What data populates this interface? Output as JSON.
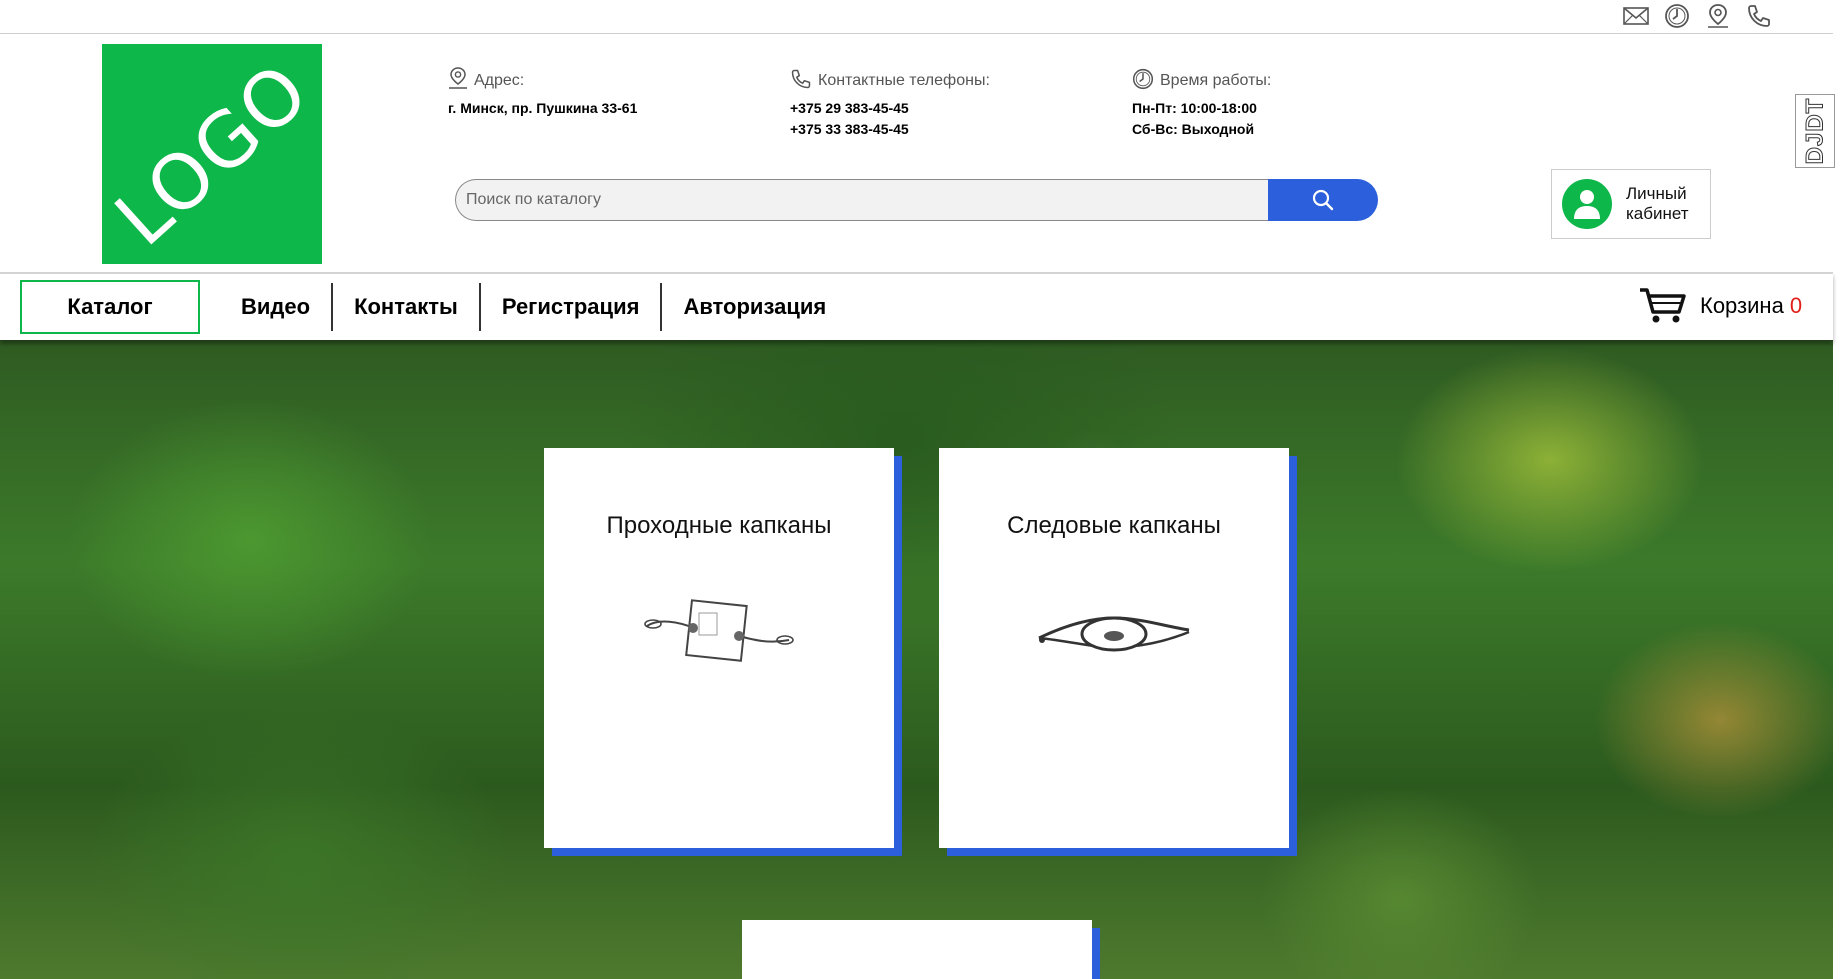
{
  "topbar": {
    "icons": [
      "mail-icon",
      "clock-icon",
      "location-pin-icon",
      "phone-icon"
    ]
  },
  "header": {
    "logo_text": "LOGO",
    "address": {
      "label": "Адрес:",
      "value": "г. Минск, пр. Пушкина 33-61"
    },
    "phones": {
      "label": "Контактные телефоны:",
      "lines": [
        "+375 29 383-45-45",
        "+375 33 383-45-45"
      ]
    },
    "hours": {
      "label": "Время работы:",
      "lines": [
        "Пн-Пт: 10:00-18:00",
        "Сб-Вс: Выходной"
      ]
    },
    "search": {
      "placeholder": "Поиск по каталогу"
    },
    "account": {
      "line1": "Личный",
      "line2": "кабинет"
    },
    "djdt": "DJDT"
  },
  "nav": {
    "catalog": "Каталог",
    "links": [
      "Видео",
      "Контакты",
      "Регистрация",
      "Авторизация"
    ],
    "cart_label": "Корзина",
    "cart_count": "0"
  },
  "categories": [
    {
      "title": "Проходные капканы"
    },
    {
      "title": "Следовые капканы"
    },
    {
      "title": ""
    }
  ],
  "colors": {
    "brand_green": "#0db74a",
    "accent_blue": "#2b5fdc",
    "cart_count_red": "#e0201b"
  }
}
